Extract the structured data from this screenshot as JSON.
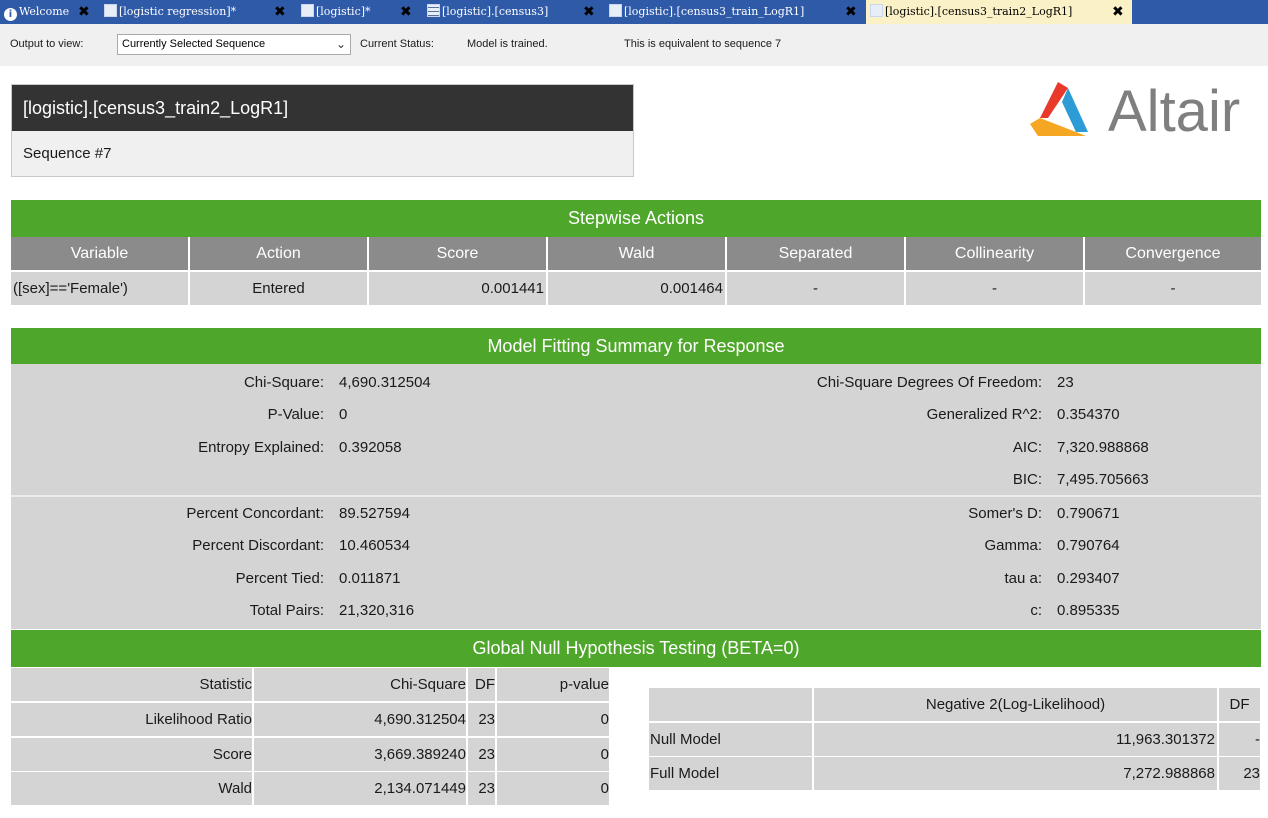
{
  "tabs": [
    {
      "label": "Welcome",
      "icon": "info-icon",
      "active": false
    },
    {
      "label": "[logistic regression]*",
      "icon": "diagram-icon",
      "active": false
    },
    {
      "label": "[logistic]*",
      "icon": "diagram-icon",
      "active": false
    },
    {
      "label": "[logistic].[census3]",
      "icon": "table-icon",
      "active": false
    },
    {
      "label": "[logistic].[census3_train_LogR1]",
      "icon": "model-icon",
      "active": false
    },
    {
      "label": "[logistic].[census3_train2_LogR1]",
      "icon": "model-icon",
      "active": true
    }
  ],
  "tab_close_glyph": "✖",
  "toolbar": {
    "output_label": "Output to view:",
    "output_selected": "Currently Selected Sequence",
    "status_label": "Current Status:",
    "status_value": "Model is trained.",
    "equivalent_text": "This is equivalent to sequence 7"
  },
  "header": {
    "title": "[logistic].[census3_train2_LogR1]",
    "sequence": "Sequence #7"
  },
  "logo": {
    "text": "Altair",
    "colors": [
      "#e8392b",
      "#f5a623",
      "#2c9bd6"
    ]
  },
  "stepwise": {
    "title": "Stepwise Actions",
    "columns": [
      "Variable",
      "Action",
      "Score",
      "Wald",
      "Separated",
      "Collinearity",
      "Convergence"
    ],
    "row": [
      "([sex]=='Female')",
      "Entered",
      "0.001441",
      "0.001464",
      "-",
      "-",
      "-"
    ]
  },
  "model_fitting": {
    "title": "Model Fitting Summary for Response",
    "left_top": [
      {
        "label": "Chi-Square:",
        "value": "4,690.312504"
      },
      {
        "label": "P-Value:",
        "value": "0"
      },
      {
        "label": "Entropy Explained:",
        "value": "0.392058"
      }
    ],
    "right_top": [
      {
        "label": "Chi-Square Degrees Of Freedom:",
        "value": "23"
      },
      {
        "label": "Generalized R^2:",
        "value": "0.354370"
      },
      {
        "label": "AIC:",
        "value": "7,320.988868"
      },
      {
        "label": "BIC:",
        "value": "7,495.705663"
      }
    ],
    "left_bottom": [
      {
        "label": "Percent Concordant:",
        "value": "89.527594"
      },
      {
        "label": "Percent Discordant:",
        "value": "10.460534"
      },
      {
        "label": "Percent Tied:",
        "value": "0.011871"
      },
      {
        "label": "Total Pairs:",
        "value": "21,320,316"
      }
    ],
    "right_bottom": [
      {
        "label": "Somer's D:",
        "value": "0.790671"
      },
      {
        "label": "Gamma:",
        "value": "0.790764"
      },
      {
        "label": "tau a:",
        "value": "0.293407"
      },
      {
        "label": "c:",
        "value": "0.895335"
      }
    ]
  },
  "global_null": {
    "title": "Global Null Hypothesis Testing (BETA=0)",
    "columns": [
      "Statistic",
      "Chi-Square",
      "DF",
      "p-value"
    ],
    "rows": [
      [
        "Likelihood Ratio",
        "4,690.312504",
        "23",
        "0"
      ],
      [
        "Score",
        "3,669.389240",
        "23",
        "0"
      ],
      [
        "Wald",
        "2,134.071449",
        "23",
        "0"
      ]
    ]
  },
  "log_likelihood": {
    "columns": [
      "",
      "Negative 2(Log-Likelihood)",
      "DF"
    ],
    "rows": [
      [
        "Null Model",
        "11,963.301372",
        "-"
      ],
      [
        "Full Model",
        "7,272.988868",
        "23"
      ]
    ]
  }
}
